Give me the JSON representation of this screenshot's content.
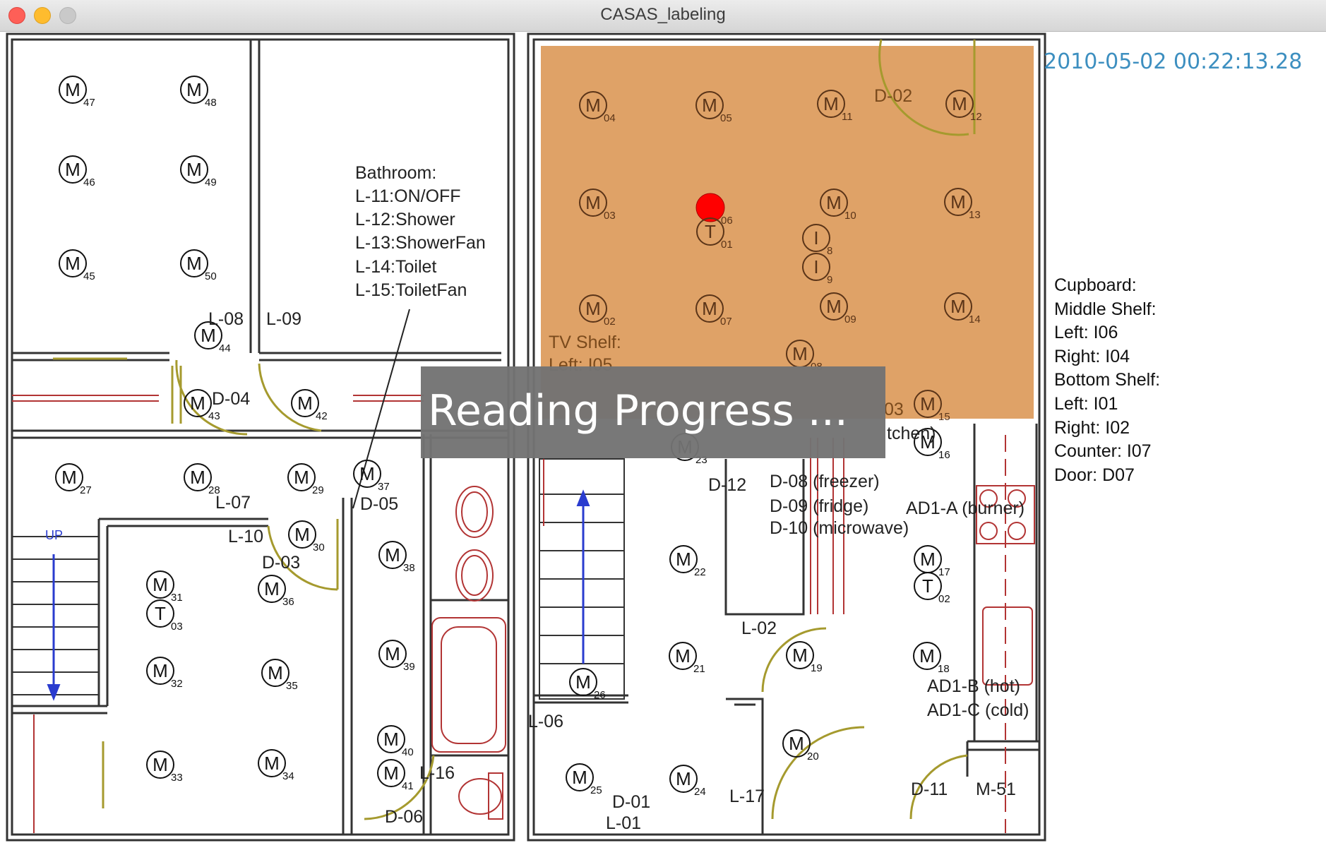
{
  "window": {
    "title": "CASAS_labeling"
  },
  "timestamp": "2010-05-02 00:22:13.28",
  "overlay": {
    "text": "Reading Progress ..."
  },
  "bathroom_legend": [
    "Bathroom:",
    "L-11:ON/OFF",
    "L-12:Shower",
    "L-13:ShowerFan",
    "L-14:Toilet",
    "L-15:ToiletFan"
  ],
  "side_legend": [
    "Cupboard:",
    "Middle Shelf:",
    "Left: I06",
    "Right: I04",
    "Bottom Shelf:",
    "Left: I01",
    "Right: I02",
    "Counter: I07",
    "",
    "Door: D07"
  ],
  "highlight_color": "#dfa267",
  "active_sensor": {
    "id": "M06",
    "color": "#ff0000"
  },
  "sensors": {
    "motion": [
      {
        "n": "M",
        "s": "47"
      },
      {
        "n": "M",
        "s": "48"
      },
      {
        "n": "M",
        "s": "46"
      },
      {
        "n": "M",
        "s": "49"
      },
      {
        "n": "M",
        "s": "45"
      },
      {
        "n": "M",
        "s": "50"
      },
      {
        "n": "M",
        "s": "44"
      },
      {
        "n": "M",
        "s": "43"
      },
      {
        "n": "M",
        "s": "42"
      },
      {
        "n": "M",
        "s": "27"
      },
      {
        "n": "M",
        "s": "28"
      },
      {
        "n": "M",
        "s": "29"
      },
      {
        "n": "M",
        "s": "37"
      },
      {
        "n": "M",
        "s": "30"
      },
      {
        "n": "M",
        "s": "31"
      },
      {
        "n": "M",
        "s": "36"
      },
      {
        "n": "M",
        "s": "32"
      },
      {
        "n": "M",
        "s": "35"
      },
      {
        "n": "M",
        "s": "33"
      },
      {
        "n": "M",
        "s": "34"
      },
      {
        "n": "M",
        "s": "38"
      },
      {
        "n": "M",
        "s": "39"
      },
      {
        "n": "M",
        "s": "40"
      },
      {
        "n": "M",
        "s": "41"
      },
      {
        "n": "M",
        "s": "04"
      },
      {
        "n": "M",
        "s": "05"
      },
      {
        "n": "M",
        "s": "11"
      },
      {
        "n": "M",
        "s": "12"
      },
      {
        "n": "M",
        "s": "03"
      },
      {
        "n": "M",
        "s": "06"
      },
      {
        "n": "M",
        "s": "10"
      },
      {
        "n": "M",
        "s": "13"
      },
      {
        "n": "M",
        "s": "02"
      },
      {
        "n": "M",
        "s": "07"
      },
      {
        "n": "M",
        "s": "09"
      },
      {
        "n": "M",
        "s": "14"
      },
      {
        "n": "M",
        "s": "08"
      },
      {
        "n": "M",
        "s": "15"
      },
      {
        "n": "M",
        "s": "16"
      },
      {
        "n": "M",
        "s": "23"
      },
      {
        "n": "M",
        "s": "22"
      },
      {
        "n": "M",
        "s": "17"
      },
      {
        "n": "M",
        "s": "21"
      },
      {
        "n": "M",
        "s": "19"
      },
      {
        "n": "M",
        "s": "18"
      },
      {
        "n": "M",
        "s": "26"
      },
      {
        "n": "M",
        "s": "20"
      },
      {
        "n": "M",
        "s": "25"
      },
      {
        "n": "M",
        "s": "24"
      }
    ],
    "temp": [
      {
        "n": "T",
        "s": "03"
      },
      {
        "n": "T",
        "s": "01"
      },
      {
        "n": "T",
        "s": "02"
      }
    ],
    "item": [
      {
        "n": "I",
        "s": "8"
      },
      {
        "n": "I",
        "s": "9"
      }
    ]
  },
  "labels": {
    "L08": "L-08",
    "L09": "L-09",
    "D04": "D-04",
    "L07": "L-07",
    "D05": "D-05",
    "L10": "L-10",
    "D03": "D-03",
    "L16": "L-16",
    "D06": "D-06",
    "D02": "D-02",
    "TVShelf": "TV Shelf:",
    "TVLeft": "Left: I05",
    "D03b": "03",
    "kitchen": "tchen)",
    "D12": "D-12",
    "D08": "D-08 (freezer)",
    "D09": "D-09 (fridge)",
    "D10": "D-10 (microwave)",
    "AD1A": "AD1-A (burner)",
    "L02": "L-02",
    "AD1B": "AD1-B (hot)",
    "AD1C": "AD1-C (cold)",
    "L06": "L-06",
    "D01": "D-01",
    "L01": "L-01",
    "L17": "L-17",
    "D11": "D-11",
    "M51": "M-51",
    "stairUp": "UP"
  }
}
